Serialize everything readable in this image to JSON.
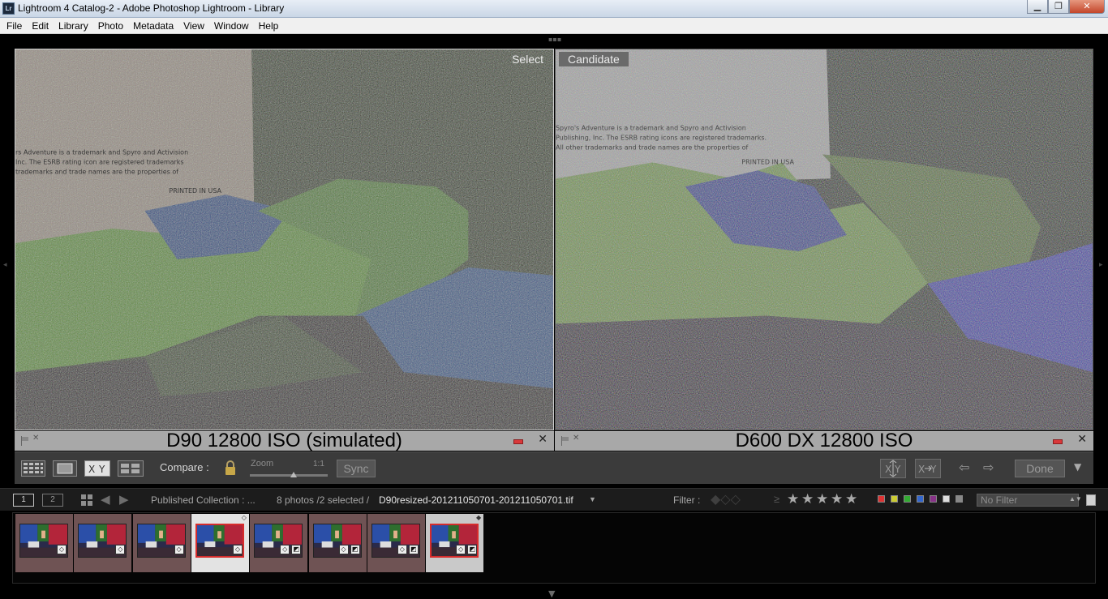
{
  "window": {
    "title": "Lightroom 4 Catalog-2 - Adobe Photoshop Lightroom - Library",
    "icon_label": "Lr",
    "buttons": [
      "minimize-icon",
      "maximize-icon",
      "close-icon"
    ]
  },
  "menu": [
    "File",
    "Edit",
    "Library",
    "Photo",
    "Metadata",
    "View",
    "Window",
    "Help"
  ],
  "compare": {
    "left": {
      "role": "Select",
      "caption": "D90 12800 ISO (simulated)"
    },
    "right": {
      "role": "Candidate",
      "caption": "D600 DX 12800 ISO"
    }
  },
  "toolbar": {
    "compare_label": "Compare :",
    "zoom_label": "Zoom",
    "zoom_ratio": "1:1",
    "sync_label": "Sync",
    "done_label": "Done"
  },
  "filmstrip_header": {
    "monitor_1": "1",
    "monitor_2": "2",
    "source": "Published Collection : ...",
    "count": "8 photos /2 selected /",
    "filename": "D90resized-201211050701-201211050701.tif",
    "filter_label": "Filter :",
    "rating_operator": "≥",
    "stars": [
      "★",
      "★",
      "★",
      "★",
      "★"
    ],
    "label_colors": [
      "#d33",
      "#cc3",
      "#3a3",
      "#36c",
      "#838",
      "#ddd",
      "#888"
    ],
    "filter_value": "No Filter"
  },
  "filmstrip": {
    "thumbnails": [
      {
        "state": "normal",
        "badges": [
          "keyword-icon"
        ]
      },
      {
        "state": "normal",
        "badges": [
          "keyword-icon"
        ]
      },
      {
        "state": "normal",
        "badges": [
          "keyword-icon"
        ]
      },
      {
        "state": "selected",
        "badges": [
          "keyword-icon"
        ]
      },
      {
        "state": "normal",
        "badges": [
          "keyword-icon",
          "develop-icon"
        ]
      },
      {
        "state": "normal",
        "badges": [
          "keyword-icon",
          "develop-icon"
        ]
      },
      {
        "state": "normal",
        "badges": [
          "keyword-icon",
          "develop-icon"
        ]
      },
      {
        "state": "candidate",
        "badges": [
          "keyword-icon",
          "develop-icon"
        ]
      }
    ]
  }
}
